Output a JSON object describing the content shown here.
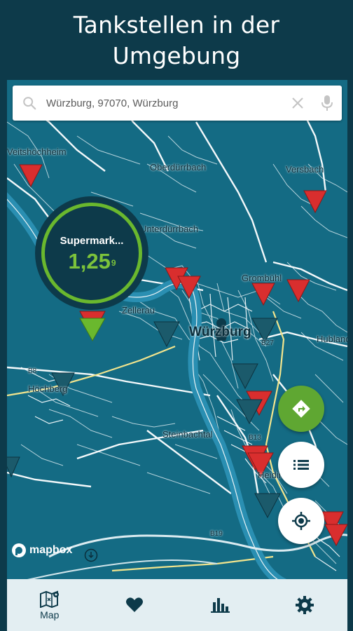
{
  "promo": {
    "title_line1": "Tankstellen in der",
    "title_line2": "Umgebung"
  },
  "search": {
    "value": "Würzburg, 97070, Würzburg",
    "search_icon": "search-icon",
    "clear_icon": "close-icon",
    "mic_icon": "mic-icon"
  },
  "map": {
    "labels": [
      {
        "text": "Veitshöchheim",
        "kind": "town"
      },
      {
        "text": "Oberdürrbach",
        "kind": "town"
      },
      {
        "text": "Versbach",
        "kind": "town"
      },
      {
        "text": "Unterdürrbach",
        "kind": "town"
      },
      {
        "text": "Zellerau",
        "kind": "town"
      },
      {
        "text": "Würzburg",
        "kind": "city"
      },
      {
        "text": "Grombühl",
        "kind": "town"
      },
      {
        "text": "Hubland",
        "kind": "town"
      },
      {
        "text": "Höchberg",
        "kind": "town"
      },
      {
        "text": "Steinbachtal",
        "kind": "town"
      },
      {
        "text": "Heidingsfeld",
        "kind": "town"
      },
      {
        "text": "B19",
        "kind": "road"
      },
      {
        "text": "B8",
        "kind": "road"
      },
      {
        "text": "B27",
        "kind": "road"
      },
      {
        "text": "B13",
        "kind": "road"
      }
    ],
    "colors": {
      "background": "#146b84",
      "roads": "#e9f3f6",
      "river": "#2a8fb2",
      "major_road": "#f3e58d",
      "marker_red": "#d92e2e",
      "marker_teal": "#1b5a6b",
      "marker_green": "#6ab82e"
    }
  },
  "selected_station": {
    "name": "Supermark...",
    "price_main": "1,25",
    "price_sup": "9"
  },
  "actions": {
    "route_icon": "directions-icon",
    "list_icon": "list-icon",
    "locate_icon": "my-location-icon"
  },
  "attribution": {
    "logo_text": "mapbox"
  },
  "bottom_nav": {
    "items": [
      {
        "label": "Map",
        "icon": "map-icon"
      },
      {
        "label": "",
        "icon": "heart-icon"
      },
      {
        "label": "",
        "icon": "bar-chart-icon"
      },
      {
        "label": "",
        "icon": "gear-icon"
      }
    ]
  }
}
